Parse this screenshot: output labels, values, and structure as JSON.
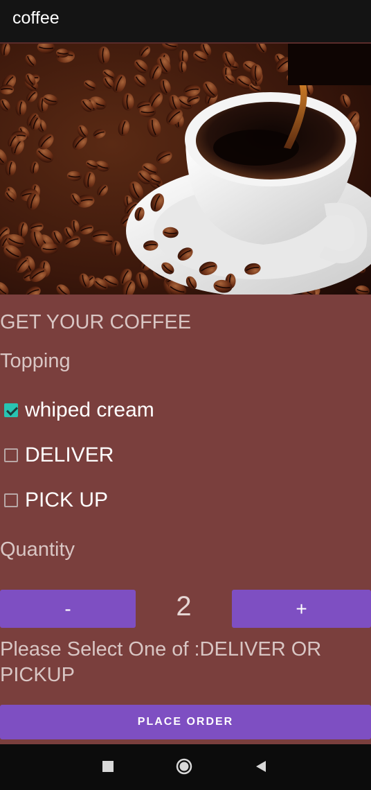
{
  "app": {
    "title": "coffee"
  },
  "hero": {
    "description_icon": "coffee-cup-with-beans-image"
  },
  "form": {
    "heading": "GET YOUR COFFEE",
    "topping_label": "Topping",
    "options": [
      {
        "label": "whiped cream",
        "checked": true
      },
      {
        "label": "DELIVER",
        "checked": false
      },
      {
        "label": "PICK UP",
        "checked": false
      }
    ],
    "quantity_label": "Quantity",
    "minus_label": "-",
    "plus_label": "+",
    "quantity_value": "2",
    "message": "Please Select One of :DELIVER OR PICKUP",
    "order_button": "PLACE ORDER"
  },
  "colors": {
    "background": "#7a3f3d",
    "accent": "#7e4fc2",
    "checkbox_checked": "#28c4b2",
    "appbar": "#141414"
  },
  "navigation": {
    "icons": [
      "square-recents-icon",
      "circle-home-icon",
      "triangle-back-icon"
    ]
  }
}
